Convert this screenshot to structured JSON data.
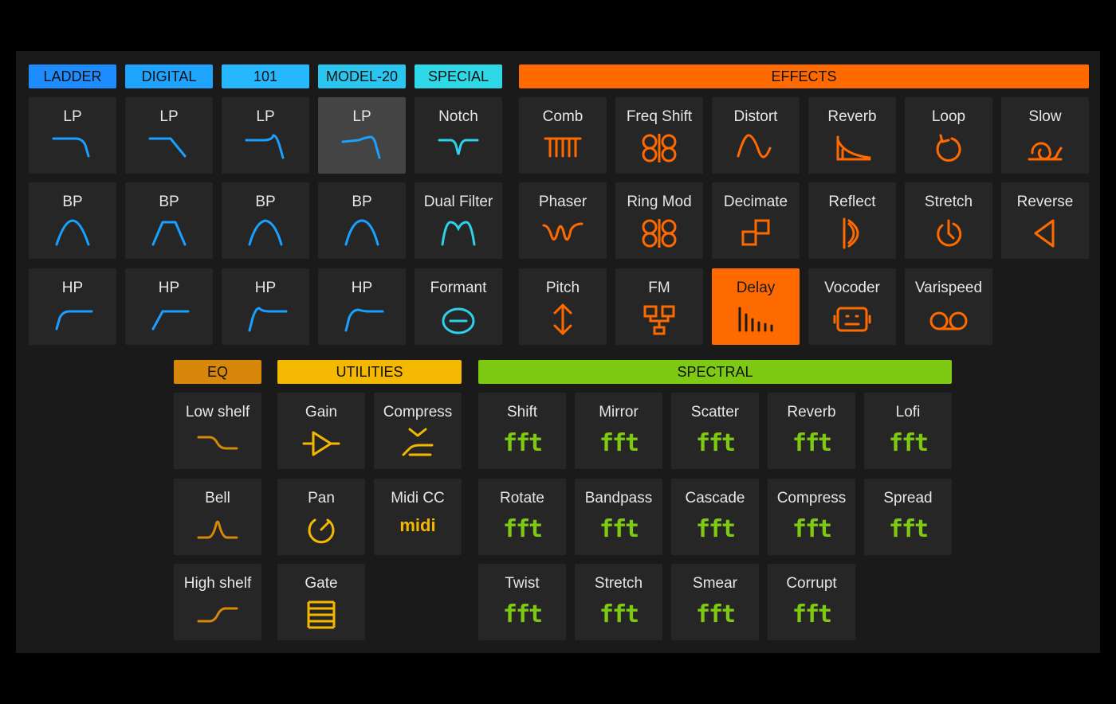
{
  "headers": {
    "ladder": "LADDER",
    "digital": "DIGITAL",
    "f101": "101",
    "model20": "MODEL-20",
    "special": "SPECIAL",
    "effects": "EFFECTS",
    "eq": "EQ",
    "utilities": "UTILITIES",
    "spectral": "SPECTRAL"
  },
  "colors": {
    "ladder": "#1c8cff",
    "digital": "#1ea4ff",
    "f101": "#26b8ff",
    "model20": "#2ac6f0",
    "special": "#2ed8e6",
    "effects": "#ff6a00",
    "eq": "#d7870a",
    "utilities": "#f5b800",
    "spectral": "#7ec912",
    "filter_icon": "#1aa0ff",
    "special_icon": "#2ed0ea",
    "effects_icon": "#ff6a00",
    "eq_icon": "#d7870a",
    "utilities_icon": "#f5b800",
    "spectral_icon": "#7ec912"
  },
  "filters": {
    "ladder": {
      "lp": "LP",
      "bp": "BP",
      "hp": "HP"
    },
    "digital": {
      "lp": "LP",
      "bp": "BP",
      "hp": "HP"
    },
    "f101": {
      "lp": "LP",
      "bp": "BP",
      "hp": "HP"
    },
    "model20": {
      "lp": "LP",
      "bp": "BP",
      "hp": "HP"
    },
    "special": {
      "notch": "Notch",
      "dual": "Dual Filter",
      "formant": "Formant"
    }
  },
  "effects": {
    "comb": "Comb",
    "freq_shift": "Freq Shift",
    "distort": "Distort",
    "reverb": "Reverb",
    "loop": "Loop",
    "slow": "Slow",
    "phaser": "Phaser",
    "ring_mod": "Ring Mod",
    "decimate": "Decimate",
    "reflect": "Reflect",
    "stretch": "Stretch",
    "reverse": "Reverse",
    "pitch": "Pitch",
    "fm": "FM",
    "delay": "Delay",
    "vocoder": "Vocoder",
    "varispeed": "Varispeed"
  },
  "eq": {
    "low_shelf": "Low shelf",
    "bell": "Bell",
    "high_shelf": "High shelf"
  },
  "utilities": {
    "gain": "Gain",
    "compress": "Compress",
    "pan": "Pan",
    "midi_cc": "Midi CC",
    "midi_icon_text": "midi",
    "gate": "Gate"
  },
  "spectral": {
    "shift": "Shift",
    "mirror": "Mirror",
    "scatter": "Scatter",
    "reverb": "Reverb",
    "lofi": "Lofi",
    "rotate": "Rotate",
    "bandpass": "Bandpass",
    "cascade": "Cascade",
    "compress": "Compress",
    "spread": "Spread",
    "twist": "Twist",
    "stretch": "Stretch",
    "smear": "Smear",
    "corrupt": "Corrupt",
    "fft_icon_text": "fft"
  },
  "selected": {
    "filter": "model20.lp",
    "effect": "delay"
  }
}
